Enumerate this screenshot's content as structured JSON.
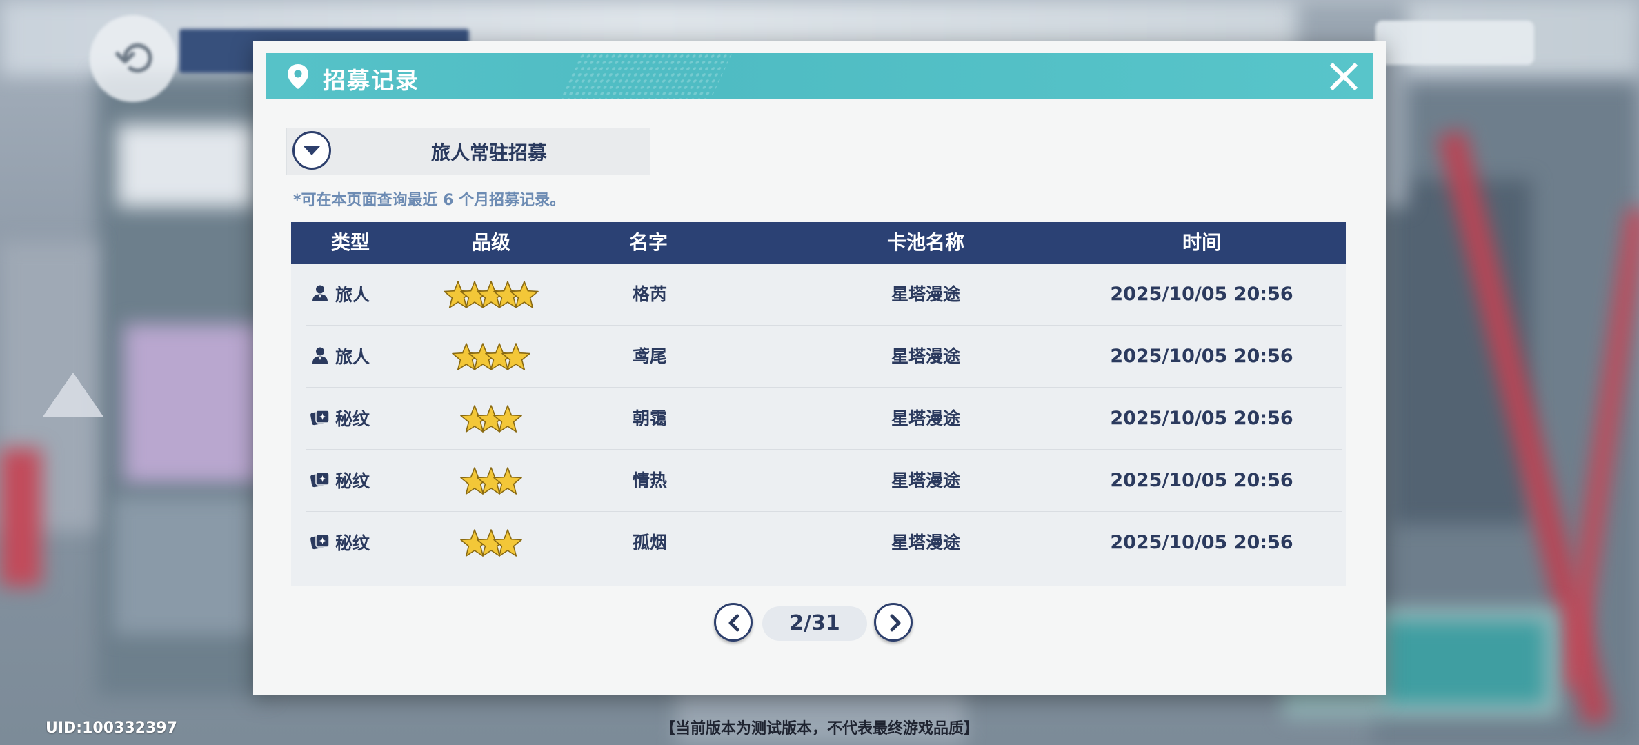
{
  "header": {
    "title": "招募记录"
  },
  "pool_select": {
    "selected": "旅人常驻招募"
  },
  "note": "*可在本页面查询最近 6 个月招募记录。",
  "columns": {
    "type": "类型",
    "rank": "品级",
    "name": "名字",
    "pool": "卡池名称",
    "time": "时间"
  },
  "records": [
    {
      "type": "旅人",
      "type_icon": "person-icon",
      "stars": 5,
      "name": "格芮",
      "pool": "星塔漫途",
      "time": "2025/10/05 20:56"
    },
    {
      "type": "旅人",
      "type_icon": "person-icon",
      "stars": 4,
      "name": "鸢尾",
      "pool": "星塔漫途",
      "time": "2025/10/05 20:56"
    },
    {
      "type": "秘纹",
      "type_icon": "card-icon",
      "stars": 3,
      "name": "朝霭",
      "pool": "星塔漫途",
      "time": "2025/10/05 20:56"
    },
    {
      "type": "秘纹",
      "type_icon": "card-icon",
      "stars": 3,
      "name": "情热",
      "pool": "星塔漫途",
      "time": "2025/10/05 20:56"
    },
    {
      "type": "秘纹",
      "type_icon": "card-icon",
      "stars": 3,
      "name": "孤烟",
      "pool": "星塔漫途",
      "time": "2025/10/05 20:56"
    }
  ],
  "pagination": {
    "label": "2/31",
    "current": 2,
    "total": 31
  },
  "footer": {
    "uid": "UID:100332397",
    "disclaimer": "【当前版本为测试版本，不代表最终游戏品质】"
  },
  "colors": {
    "accent_teal": "#4fbcc3",
    "navy": "#2b4174",
    "star_gold": "#f3c738"
  }
}
